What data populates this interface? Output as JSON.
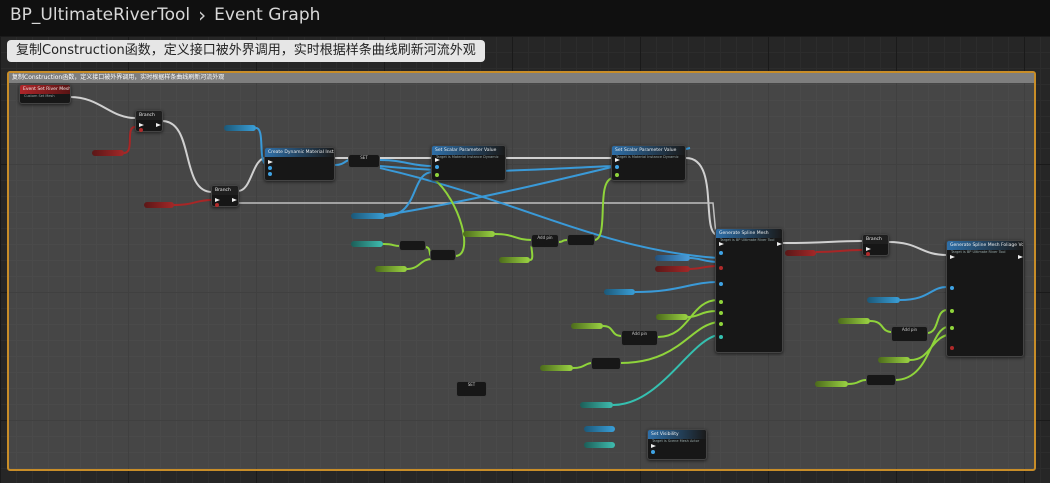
{
  "breadcrumb": {
    "blueprint": "BP_UltimateRiverTool",
    "graph": "Event Graph"
  },
  "tooltip": "复制Construction函数，定义接口被外界调用，实时根据样条曲线刷新河流外观",
  "comment": {
    "text": "复制Construction函数，定义接口被外界调用，实时根据样条曲线刷新河流外观"
  },
  "nodes": {
    "event": {
      "title": "Event Set River Mesh",
      "sub": "Custom Set Mesh"
    },
    "branch1": {
      "title": "Branch"
    },
    "branch2": {
      "title": "Branch"
    },
    "branch3": {
      "title": "Branch"
    },
    "create_dmi": {
      "title": "Create Dynamic Material Instance"
    },
    "set_param1": {
      "title": "Set Scalar Parameter Value",
      "sub": "Target is Material Instance Dynamic"
    },
    "set_param2": {
      "title": "Set Scalar Parameter Value",
      "sub": "Target is Material Instance Dynamic"
    },
    "gen_mesh": {
      "title": "Generate Spline Mesh",
      "sub": "Target is BP Ultimate River Tool"
    },
    "gen_foliage": {
      "title": "Generate Spline Mesh Foliage Volume",
      "sub": "Target is BP Ultimate River Tool"
    },
    "set_visibility": {
      "title": "Set Visibility",
      "sub": "Target is Scene Mesh Actor"
    },
    "math_add": "Add pin",
    "set_label": "SET"
  },
  "colors": {
    "exec": "#eeeeee",
    "object": "#3fa3e4",
    "float": "#8fd43b",
    "bool": "#b02a2a",
    "vector": "#35c0b0",
    "comment_border": "#c88d28"
  }
}
